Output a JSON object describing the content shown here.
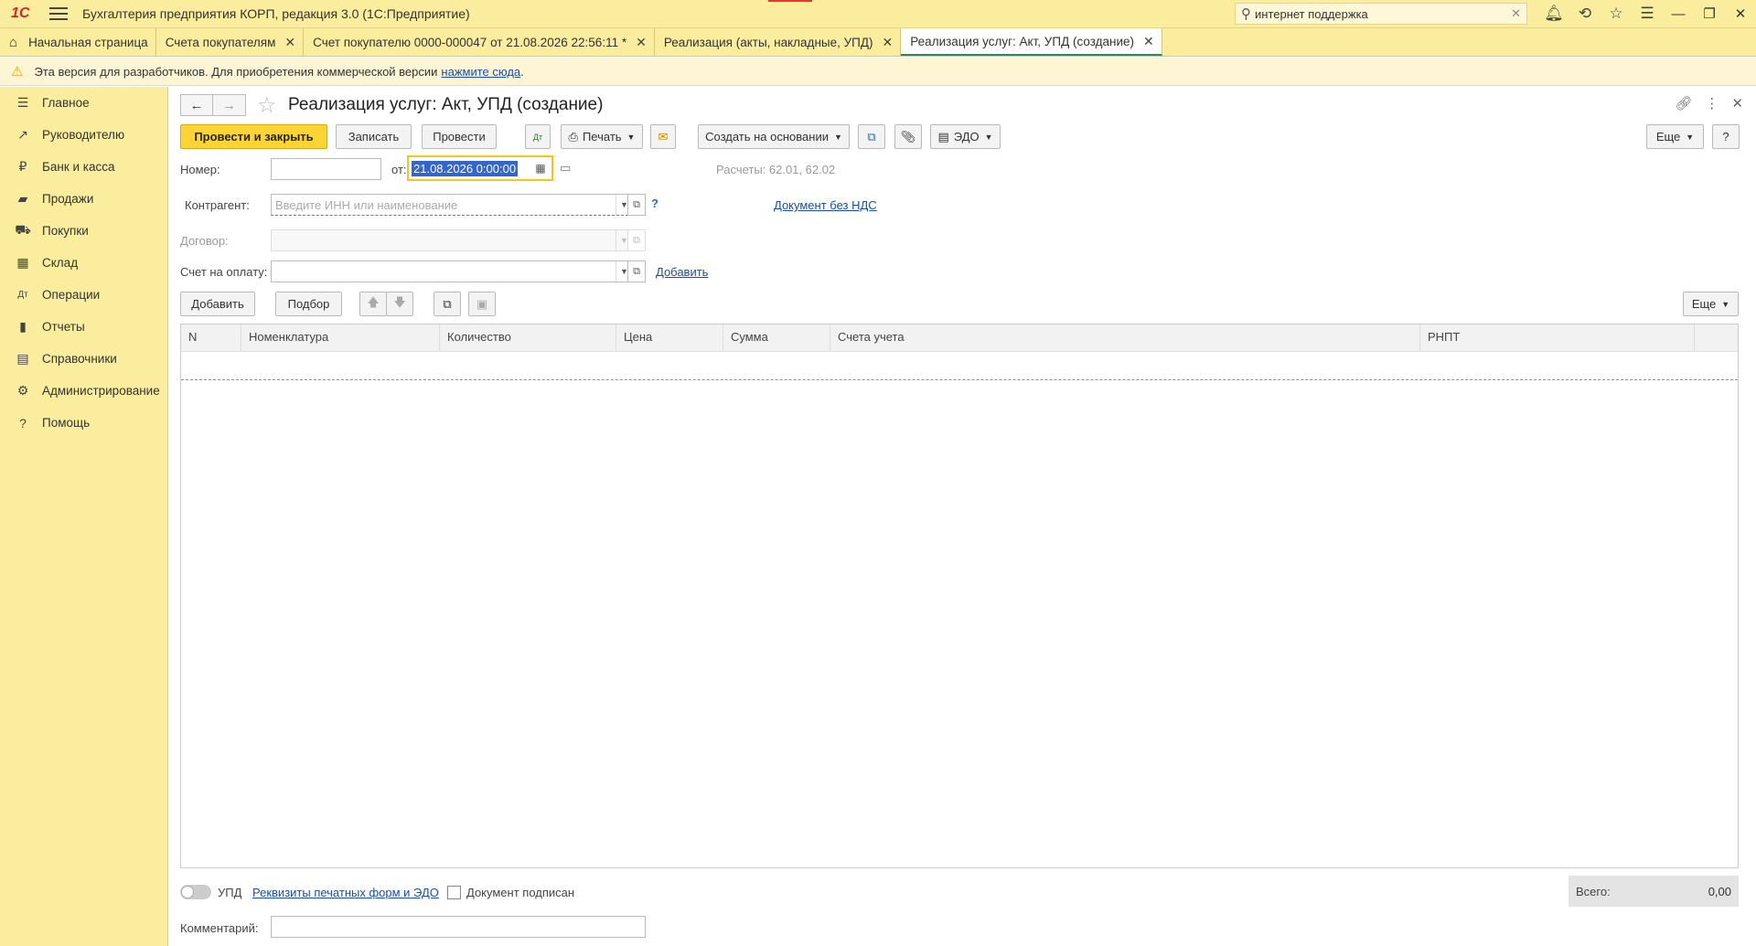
{
  "app": {
    "logo": "1С",
    "title": "Бухгалтерия предприятия КОРП, редакция 3.0  (1С:Предприятие)",
    "search_value": "интернет поддержка"
  },
  "tabs": [
    {
      "label": "Начальная страница"
    },
    {
      "label": "Счета покупателям"
    },
    {
      "label": "Счет покупателю 0000-000047 от 21.08.2026 22:56:11 *"
    },
    {
      "label": "Реализация (акты, накладные, УПД)"
    },
    {
      "label": "Реализация услуг: Акт, УПД (создание)"
    }
  ],
  "banner": {
    "text": "Эта версия для разработчиков. Для приобретения коммерческой версии",
    "link": "нажмите сюда",
    "period": "."
  },
  "sidebar": {
    "items": [
      {
        "label": "Главное",
        "icon": "menu-icon"
      },
      {
        "label": "Руководителю",
        "icon": "trend-icon"
      },
      {
        "label": "Банк и касса",
        "icon": "ruble-icon"
      },
      {
        "label": "Продажи",
        "icon": "bag-icon"
      },
      {
        "label": "Покупки",
        "icon": "cart-icon"
      },
      {
        "label": "Склад",
        "icon": "warehouse-icon"
      },
      {
        "label": "Операции",
        "icon": "dt-kt-icon"
      },
      {
        "label": "Отчеты",
        "icon": "chart-icon"
      },
      {
        "label": "Справочники",
        "icon": "books-icon"
      },
      {
        "label": "Администрирование",
        "icon": "gear-icon"
      },
      {
        "label": "Помощь",
        "icon": "help-icon"
      }
    ]
  },
  "doc": {
    "title": "Реализация услуг: Акт, УПД (создание)",
    "toolbar": {
      "post_close": "Провести и закрыть",
      "save": "Записать",
      "post": "Провести",
      "print": "Печать",
      "create_based": "Создать на основании",
      "edo": "ЭДО",
      "more": "Еще",
      "help": "?"
    },
    "form": {
      "number_label": "Номер:",
      "number_value": "",
      "from_label": "от:",
      "date_value": "21.08.2026  0:00:00",
      "settlements": "Расчеты: 62.01, 62.02",
      "counterparty_label": "Контрагент:",
      "counterparty_placeholder": "Введите ИНН или наименование",
      "question": "?",
      "no_vat_link": "Документ без НДС",
      "contract_label": "Договор:",
      "invoice_label": "Счет на оплату:",
      "add_link": "Добавить"
    },
    "table_toolbar": {
      "add": "Добавить",
      "pick": "Подбор",
      "more": "Еще"
    },
    "table": {
      "columns": [
        "N",
        "Номенклатура",
        "Количество",
        "Цена",
        "Сумма",
        "Счета учета",
        "РНПТ"
      ]
    },
    "footer": {
      "upd_label": "УПД",
      "print_forms_link": "Реквизиты печатных форм и ЭДО",
      "signed_label": "Документ подписан",
      "total_label": "Всего:",
      "total_value": "0,00",
      "comment_label": "Комментарий:",
      "comment_value": ""
    }
  }
}
